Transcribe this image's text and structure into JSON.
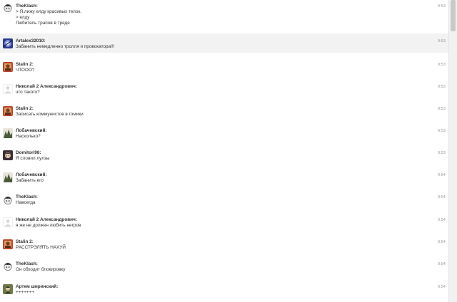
{
  "messages": [
    {
      "author": "TheKlash:",
      "lines": [
        "> Я.лижу елду красивых телок.",
        "> елду",
        "Любитель трапов в треде"
      ],
      "time": "9:53",
      "avatar": "klash-avatar"
    },
    {
      "author": "Artalex32010:",
      "lines": [
        "Забанить немедленно тролля и провокатора!!!"
      ],
      "time": "9:53",
      "avatar": "artalex-avatar"
    },
    {
      "author": "Stalin 2:",
      "lines": [
        "ЧТООО?"
      ],
      "time": "9:53",
      "avatar": "stalin-avatar"
    },
    {
      "author": "Николай 2 Александрович:",
      "lines": [
        "что такого?"
      ],
      "time": "9:53",
      "avatar": "default-avatar"
    },
    {
      "author": "Stalin 2:",
      "lines": [
        "Записать коммунистов в гомики"
      ],
      "time": "9:53",
      "avatar": "stalin-avatar"
    },
    {
      "author": "Лобачевский:",
      "lines": [
        "Насколько?"
      ],
      "time": "9:53",
      "avatar": "lobachevsky-avatar"
    },
    {
      "author": "Domitori98:",
      "lines": [
        "Я словил лулзы"
      ],
      "time": "9:53",
      "avatar": "domitori-avatar"
    },
    {
      "author": "Лобачевский:",
      "lines": [
        "Забанить его"
      ],
      "time": "9:54",
      "avatar": "lobachevsky-avatar"
    },
    {
      "author": "TheKlash:",
      "lines": [
        "Навсегда"
      ],
      "time": "9:54",
      "avatar": "klash-avatar"
    },
    {
      "author": "Николай 2 Александрович:",
      "lines": [
        "я же не должен любить негров"
      ],
      "time": "9:54",
      "avatar": "default-avatar"
    },
    {
      "author": "Stalin 2:",
      "lines": [
        "РАССТРЭЛЯТЬ НАХУЙ"
      ],
      "time": "9:54",
      "avatar": "stalin-avatar"
    },
    {
      "author": "TheKlash:",
      "lines": [
        "Он обходит блокировку"
      ],
      "time": "9:54",
      "avatar": "klash-avatar"
    },
    {
      "author": "Артем ширинский:",
      "lines": [
        "+++++++"
      ],
      "time": "9:54",
      "avatar": "artem-avatar"
    }
  ],
  "highlight_index": 1,
  "colors": {
    "highlight_bg": "#f2f2f2",
    "text": "#333333",
    "time": "#999999"
  }
}
